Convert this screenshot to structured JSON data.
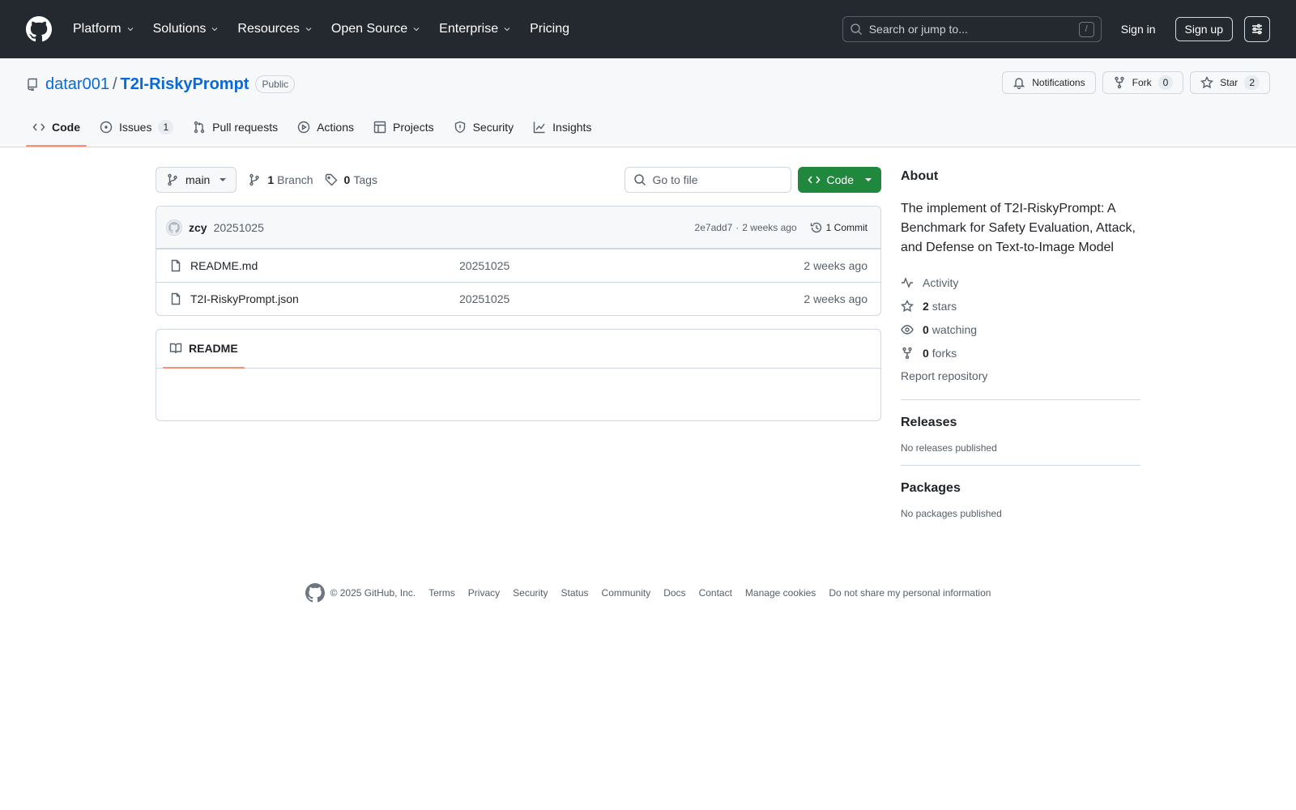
{
  "header": {
    "nav": [
      "Platform",
      "Solutions",
      "Resources",
      "Open Source",
      "Enterprise",
      "Pricing"
    ],
    "search_placeholder": "Search or jump to...",
    "search_shortcut": "/",
    "sign_in": "Sign in",
    "sign_up": "Sign up"
  },
  "repo": {
    "owner": "datar001",
    "separator": "/",
    "name": "T2I-RiskyPrompt",
    "visibility": "Public",
    "actions": {
      "notifications": "Notifications",
      "fork": "Fork",
      "fork_count": "0",
      "star": "Star",
      "star_count": "2"
    },
    "tabs": [
      {
        "label": "Code",
        "icon": "code-icon"
      },
      {
        "label": "Issues",
        "count": "1",
        "icon": "issue-icon"
      },
      {
        "label": "Pull requests",
        "icon": "pull-request-icon"
      },
      {
        "label": "Actions",
        "icon": "play-icon"
      },
      {
        "label": "Projects",
        "icon": "table-icon"
      },
      {
        "label": "Security",
        "icon": "shield-icon"
      },
      {
        "label": "Insights",
        "icon": "graph-icon"
      }
    ]
  },
  "toolbar": {
    "branch": "main",
    "branch_count": "1",
    "branch_label": "Branch",
    "tag_count": "0",
    "tag_label": "Tags",
    "goto_placeholder": "Go to file",
    "code_button": "Code"
  },
  "commit": {
    "author": "zcy",
    "message": "20251025",
    "hash": "2e7add7",
    "dot": "·",
    "age": "2 weeks ago",
    "count_label": "1 Commit"
  },
  "files": [
    {
      "name": "README.md",
      "commit": "20251025",
      "age": "2 weeks ago"
    },
    {
      "name": "T2I-RiskyPrompt.json",
      "commit": "20251025",
      "age": "2 weeks ago"
    }
  ],
  "readme": {
    "tab": "README"
  },
  "about": {
    "title": "About",
    "description": "The implement of T2I-RiskyPrompt: A Benchmark for Safety Evaluation, Attack, and Defense on Text-to-Image Model",
    "activity": "Activity",
    "stars_count": "2",
    "stars_label": "stars",
    "watching_count": "0",
    "watching_label": "watching",
    "forks_count": "0",
    "forks_label": "forks",
    "report": "Report repository"
  },
  "releases": {
    "title": "Releases",
    "note": "No releases published"
  },
  "packages": {
    "title": "Packages",
    "note": "No packages published"
  },
  "footer": {
    "copyright": "© 2025 GitHub, Inc.",
    "links": [
      "Terms",
      "Privacy",
      "Security",
      "Status",
      "Community",
      "Docs",
      "Contact",
      "Manage cookies",
      "Do not share my personal information"
    ]
  },
  "colors": {
    "header_bg": "#24292f",
    "link_blue": "#0969da",
    "code_button_green": "#1f883d",
    "tab_underline": "#fd8c73"
  }
}
